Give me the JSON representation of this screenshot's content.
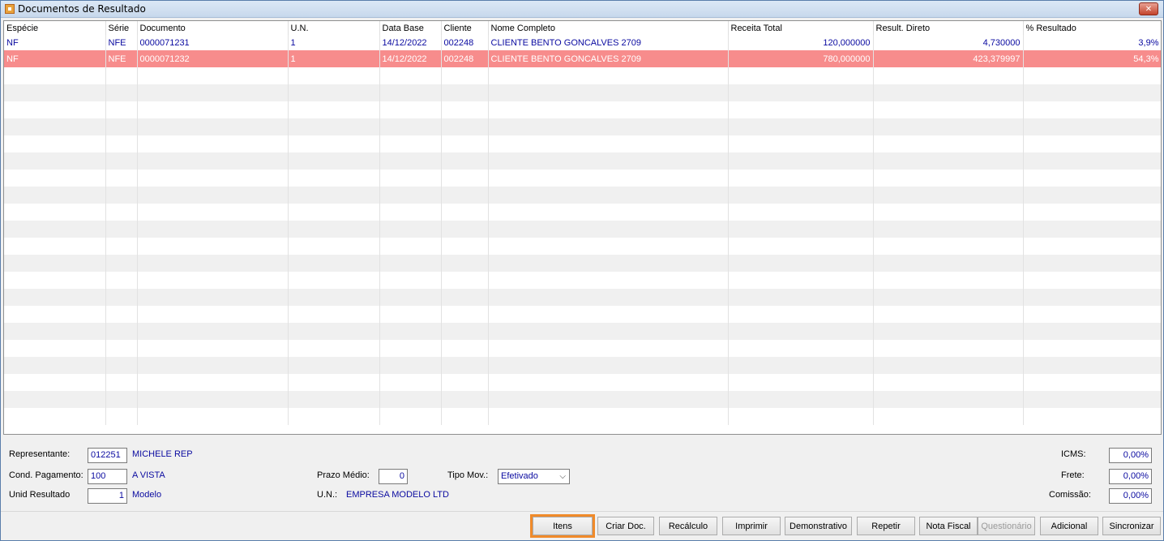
{
  "window": {
    "title": "Documentos de Resultado",
    "close_glyph": "✕"
  },
  "grid": {
    "columns": [
      "Espécie",
      "Série",
      "Documento",
      "U.N.",
      "Data Base",
      "Cliente",
      "Nome Completo",
      "Receita Total",
      "Result. Direto",
      "% Resultado"
    ],
    "rows": [
      {
        "especie": "NF",
        "serie": "NFE",
        "documento": "0000071231",
        "un": "1",
        "data_base": "14/12/2022",
        "cliente": "002248",
        "nome": "CLIENTE BENTO GONCALVES 2709",
        "receita": "120,000000",
        "resultado": "4,730000",
        "pct": "3,9%"
      },
      {
        "especie": "NF",
        "serie": "NFE",
        "documento": "0000071232",
        "un": "1",
        "data_base": "14/12/2022",
        "cliente": "002248",
        "nome": "CLIENTE BENTO GONCALVES 2709",
        "receita": "780,000000",
        "resultado": "423,379997",
        "pct": "54,3%"
      }
    ],
    "selected_row_color": "#f78c8c"
  },
  "details": {
    "representante_label": "Representante:",
    "representante_code": "012251",
    "representante_name": "MICHELE REP",
    "cond_pagamento_label": "Cond. Pagamento:",
    "cond_pagamento_code": "100",
    "cond_pagamento_name": "A VISTA",
    "unid_resultado_label": "Unid Resultado",
    "unid_resultado_value": "1",
    "unid_resultado_name": "Modelo",
    "prazo_medio_label": "Prazo Médio:",
    "prazo_medio_value": "0",
    "tipo_mov_label": "Tipo Mov.:",
    "tipo_mov_value": "Efetivado",
    "un_label": "U.N.:",
    "un_value": "EMPRESA MODELO LTD",
    "icms_label": "ICMS:",
    "icms_value": "0,00%",
    "frete_label": "Frete:",
    "frete_value": "0,00%",
    "comissao_label": "Comissão:",
    "comissao_value": "0,00%"
  },
  "buttons": {
    "itens": "Itens",
    "criar_doc": "Criar Doc.",
    "recalculo": "Recálculo",
    "imprimir": "Imprimir",
    "demonstrativo": "Demonstrativo",
    "repetir": "Repetir",
    "nota_fiscal": "Nota Fiscal",
    "questionario": "Questionário",
    "adicional": "Adicional",
    "sincronizar": "Sincronizar"
  }
}
